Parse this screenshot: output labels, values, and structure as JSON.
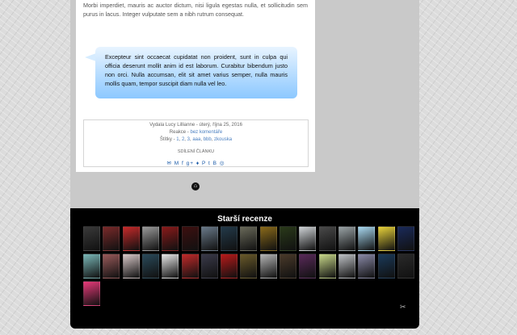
{
  "post": {
    "intro_text": "Morbi imperdiet, mauris ac auctor dictum, nisi ligula egestas nulla, et sollicitudin sem purus in lacus. Integer vulputate sem a nibh rutrum consequat.",
    "quote_text": "Excepteur sint occaecat cupidatat non proident, sunt in culpa qui officia deserunt mollit anim id est laborum. Curabitur bibendum justo non orci. Nulla accumsan, elit sit amet varius semper, nulla mauris mollis quam, tempor suscipit diam nulla vel leo."
  },
  "meta": {
    "author_date": "Vydala Lucy Lillianne - úterý, října 25, 2016",
    "reactions_label": "Reakce -",
    "reactions_link": "bez komentáře",
    "tags_label": "Štítky -",
    "tags": [
      "1",
      "2",
      "3",
      "aaa",
      "bbb",
      "zkouska"
    ],
    "share_label": "SDÍLENÍ ČLÁNKU",
    "share_icons": [
      "email-icon",
      "gmail-icon",
      "facebook-icon",
      "googleplus-icon",
      "twitter-icon",
      "pinterest-icon",
      "tumblr-icon",
      "blogger-icon",
      "reddit-icon"
    ]
  },
  "reviews": {
    "title": "Starší recenze",
    "cover_colors": [
      "#3a3a3a",
      "#7a2a2a",
      "#c62a2a",
      "#9a9a9a",
      "#8a1a1a",
      "#3d0f0f",
      "#6a7a8a",
      "#233a4a",
      "#6a6a5a",
      "#8a6a1a",
      "#2a3a1a",
      "#cfd3d6",
      "#4a4a4a",
      "#9aa3a6",
      "#a8d8f0",
      "#e8d23a",
      "#1a2a5a",
      "#7ab8b8",
      "#9a5a5a",
      "#d8c8c8",
      "#2a4a5a",
      "#e8e8e8",
      "#c22a2a",
      "#3a3a4a",
      "#b81a1a",
      "#6a5a2a",
      "#b5b5b5",
      "#4a3a2a",
      "#5a2a5a",
      "#c8d88a",
      "#bfc2c6",
      "#8a8aa8",
      "#1a3a5a",
      "#2a2a2a",
      "#e83a7a"
    ]
  }
}
